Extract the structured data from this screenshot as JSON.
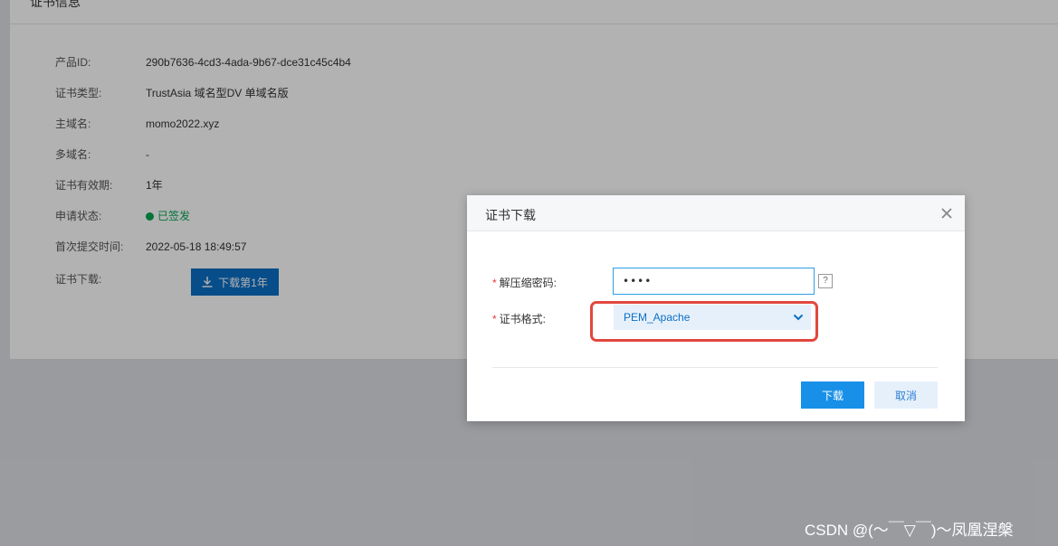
{
  "panel": {
    "title": "证书信息",
    "rows": [
      {
        "label": "产品ID:",
        "value": "290b7636-4cd3-4ada-9b67-dce31c45c4b4"
      },
      {
        "label": "证书类型:",
        "value": "TrustAsia 域名型DV 单域名版"
      },
      {
        "label": "主域名:",
        "value": "momo2022.xyz"
      },
      {
        "label": "多域名:",
        "value": "-"
      },
      {
        "label": "证书有效期:",
        "value": "1年"
      },
      {
        "label": "申请状态:",
        "value": "已签发"
      },
      {
        "label": "首次提交时间:",
        "value": "2022-05-18 18:49:57"
      },
      {
        "label": "证书下载:",
        "value": "下载第1年"
      }
    ],
    "status_color": "#00a854",
    "download_icon": "download-icon"
  },
  "dialog": {
    "title": "证书下载",
    "close_icon": "close-icon",
    "password_label": "解压缩密码:",
    "password_value": "••••",
    "help_label": "?",
    "format_label": "证书格式:",
    "format_value": "PEM_Apache",
    "required_mark": "*",
    "ok_label": "下载",
    "cancel_label": "取消",
    "accent_color": "#1890e8",
    "highlight_color": "#e2473e"
  },
  "watermark": "CSDN @(～￣▽￣)～凤凰涅槃"
}
